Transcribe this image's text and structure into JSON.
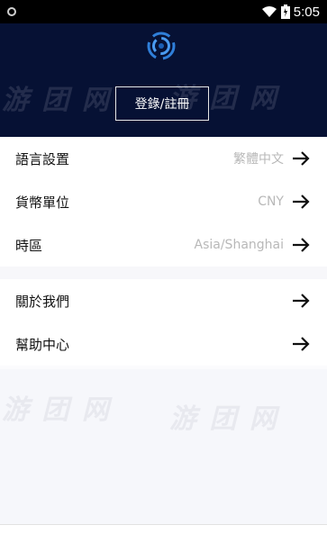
{
  "status_bar": {
    "time": "5:05",
    "icons": [
      "shield-icon",
      "wifi-icon",
      "battery-icon"
    ]
  },
  "header": {
    "logo_icon": "ring-logo-icon",
    "login_label": "登錄/註冊"
  },
  "menu": {
    "group1": [
      {
        "label": "語言設置",
        "value": "繁體中文",
        "icon": "arrow-right-icon"
      },
      {
        "label": "貨幣單位",
        "value": "CNY",
        "icon": "arrow-right-icon"
      },
      {
        "label": "時區",
        "value": "Asia/Shanghai",
        "icon": "arrow-right-icon"
      }
    ],
    "group2": [
      {
        "label": "關於我們",
        "icon": "arrow-right-icon"
      },
      {
        "label": "幫助中心",
        "icon": "arrow-right-icon"
      }
    ]
  },
  "watermark": "游 团 网",
  "colors": {
    "header_bg": "#061134",
    "logo_blue": "#2f7fd9",
    "value_gray": "#b8b8b8",
    "text_dark": "#111111"
  }
}
